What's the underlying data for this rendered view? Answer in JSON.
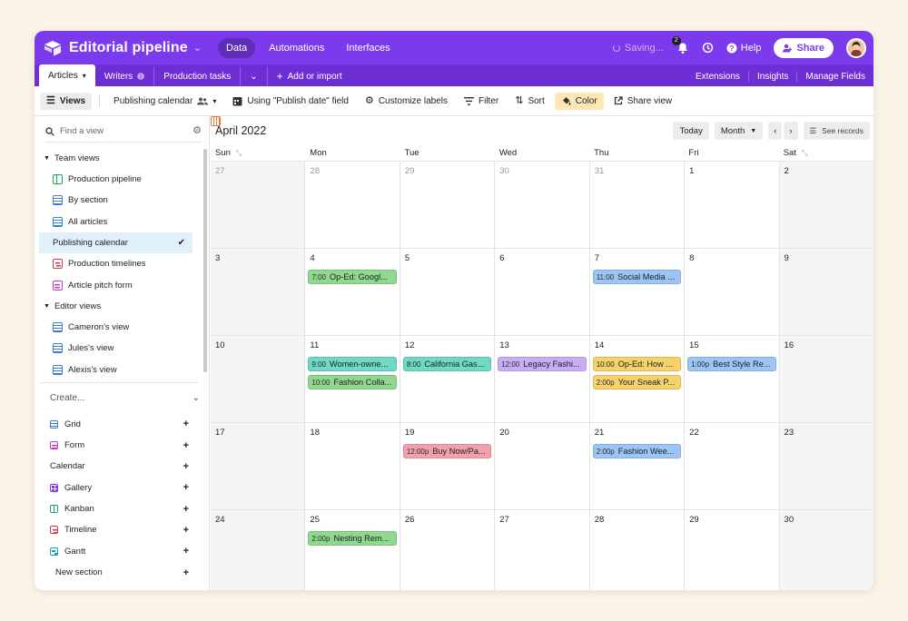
{
  "header": {
    "base_title": "Editorial pipeline",
    "nav": [
      "Data",
      "Automations",
      "Interfaces"
    ],
    "saving": "Saving...",
    "notif_count": "2",
    "help": "Help",
    "share": "Share"
  },
  "tabs": {
    "items": [
      "Articles",
      "Writers",
      "Production tasks"
    ],
    "add_import": "Add or import",
    "right": [
      "Extensions",
      "Insights",
      "Manage Fields"
    ]
  },
  "toolbar": {
    "views": "Views",
    "current_view": "Publishing calendar",
    "using_field": "Using \"Publish date\" field",
    "customize": "Customize labels",
    "filter": "Filter",
    "sort": "Sort",
    "color": "Color",
    "share_view": "Share view"
  },
  "sidebar": {
    "find_placeholder": "Find a view",
    "team_views": {
      "title": "Team views",
      "items": [
        {
          "label": "Production pipeline",
          "icon": "kanban"
        },
        {
          "label": "By section",
          "icon": "grid"
        },
        {
          "label": "All articles",
          "icon": "grid"
        },
        {
          "label": "Publishing calendar",
          "icon": "cal"
        },
        {
          "label": "Production timelines",
          "icon": "timeline"
        },
        {
          "label": "Article pitch form",
          "icon": "form"
        }
      ]
    },
    "editor_views": {
      "title": "Editor views",
      "items": [
        {
          "label": "Cameron's view",
          "icon": "grid"
        },
        {
          "label": "Jules's view",
          "icon": "grid"
        },
        {
          "label": "Alexis's view",
          "icon": "grid"
        }
      ]
    },
    "create": {
      "title": "Create...",
      "items": [
        {
          "label": "Grid",
          "icon": "grid"
        },
        {
          "label": "Form",
          "icon": "form"
        },
        {
          "label": "Calendar",
          "icon": "cal"
        },
        {
          "label": "Gallery",
          "icon": "gallery"
        },
        {
          "label": "Kanban",
          "icon": "kanban"
        },
        {
          "label": "Timeline",
          "icon": "timeline"
        },
        {
          "label": "Gantt",
          "icon": "gantt"
        }
      ],
      "new_section": "New section"
    }
  },
  "calendar": {
    "month": "April 2022",
    "today": "Today",
    "mode": "Month",
    "see_records": "See records",
    "weekdays": [
      "Sun",
      "Mon",
      "Tue",
      "Wed",
      "Thu",
      "Fri",
      "Sat"
    ],
    "weeks": [
      [
        {
          "d": "27",
          "other": true
        },
        {
          "d": "28",
          "other": true
        },
        {
          "d": "29",
          "other": true
        },
        {
          "d": "30",
          "other": true
        },
        {
          "d": "31",
          "other": true
        },
        {
          "d": "1"
        },
        {
          "d": "2"
        }
      ],
      [
        {
          "d": "3"
        },
        {
          "d": "4",
          "events": [
            {
              "time": "7:00",
              "title": "Op-Ed: Googl...",
              "color": "green"
            }
          ]
        },
        {
          "d": "5"
        },
        {
          "d": "6"
        },
        {
          "d": "7",
          "events": [
            {
              "time": "11:00",
              "title": "Social Media ...",
              "color": "blue"
            }
          ]
        },
        {
          "d": "8"
        },
        {
          "d": "9"
        }
      ],
      [
        {
          "d": "10"
        },
        {
          "d": "11",
          "events": [
            {
              "time": "9:00",
              "title": "Women-owne...",
              "color": "teal"
            },
            {
              "time": "10:00",
              "title": "Fashion Colla...",
              "color": "green"
            }
          ]
        },
        {
          "d": "12",
          "events": [
            {
              "time": "8:00",
              "title": "California Gas...",
              "color": "teal"
            }
          ]
        },
        {
          "d": "13",
          "events": [
            {
              "time": "12:00",
              "title": "Legacy Fashi...",
              "color": "purple"
            }
          ]
        },
        {
          "d": "14",
          "events": [
            {
              "time": "10:00",
              "title": "Op-Ed: How ...",
              "color": "yellow"
            },
            {
              "time": "2:00p",
              "title": "Your Sneak P...",
              "color": "yellow"
            }
          ]
        },
        {
          "d": "15",
          "events": [
            {
              "time": "1:00p",
              "title": "Best Style Re...",
              "color": "blue"
            }
          ]
        },
        {
          "d": "16"
        }
      ],
      [
        {
          "d": "17"
        },
        {
          "d": "18"
        },
        {
          "d": "19",
          "events": [
            {
              "time": "12:00p",
              "title": "Buy Now/Pa...",
              "color": "red"
            }
          ]
        },
        {
          "d": "20"
        },
        {
          "d": "21",
          "events": [
            {
              "time": "2:00p",
              "title": "Fashion Wee...",
              "color": "blue"
            }
          ]
        },
        {
          "d": "22"
        },
        {
          "d": "23"
        }
      ],
      [
        {
          "d": "24"
        },
        {
          "d": "25",
          "events": [
            {
              "time": "2:00p",
              "title": "Nesting Rem...",
              "color": "green"
            }
          ]
        },
        {
          "d": "26"
        },
        {
          "d": "27"
        },
        {
          "d": "28"
        },
        {
          "d": "29"
        },
        {
          "d": "30"
        }
      ]
    ]
  },
  "colors": {
    "brand": "#7c3aed",
    "tab_bar": "#6d2ed6",
    "active_view": "#dff0f9",
    "color_button": "#fde7b4"
  }
}
